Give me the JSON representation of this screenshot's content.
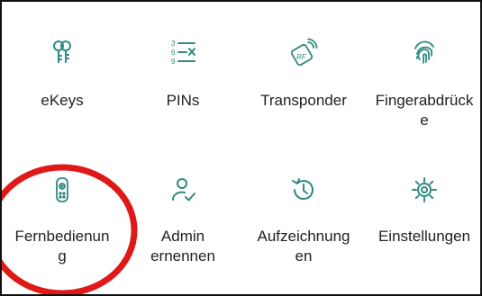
{
  "accent": "#2f8a80",
  "annotation_color": "#e01818",
  "tiles": [
    {
      "label": "eKeys",
      "icon": "ekey-icon"
    },
    {
      "label": "PINs",
      "icon": "pin-list-icon"
    },
    {
      "label": "Transponder",
      "icon": "rf-card-icon"
    },
    {
      "label": "Fingerabdrück\ne",
      "icon": "fingerprint-icon"
    },
    {
      "label": "Fernbedienun\ng",
      "icon": "remote-control-icon"
    },
    {
      "label": "Admin\nernennen",
      "icon": "admin-user-icon"
    },
    {
      "label": "Aufzeichnung\nen",
      "icon": "history-clock-icon"
    },
    {
      "label": "Einstellungen",
      "icon": "gear-icon"
    }
  ]
}
